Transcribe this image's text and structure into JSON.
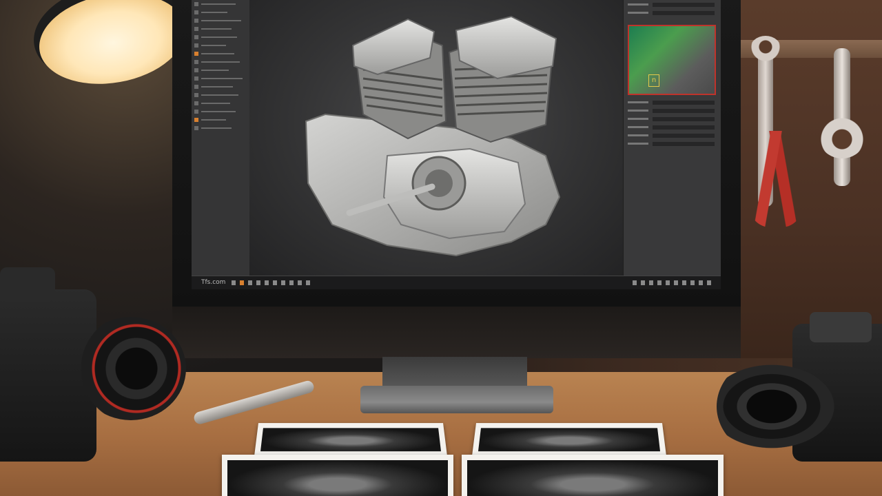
{
  "scene": {
    "description_tag": "workspace-photo",
    "accent_color": "#d8802f",
    "highlight_border_color": "#c0332b"
  },
  "app": {
    "taskbar": {
      "label": "Tfs.com"
    }
  }
}
